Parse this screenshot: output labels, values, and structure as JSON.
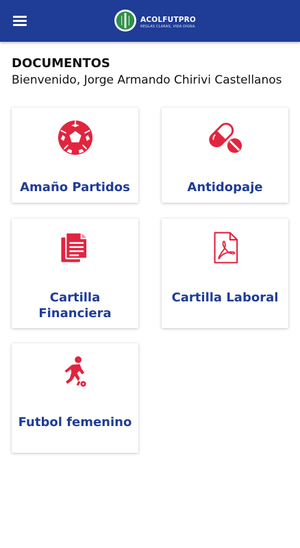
{
  "header": {
    "menu_icon": "hamburger-menu-icon",
    "logo": {
      "name": "ACOLFUTPRO",
      "tagline": "REGLAS CLARAS, VIDA DIGNA."
    }
  },
  "page": {
    "title": "DOCUMENTOS",
    "welcome": "Bienvenido, Jorge Armando Chirivi Castellanos"
  },
  "documents": [
    {
      "label": "Amaño Partidos",
      "icon": "soccer-ball-icon"
    },
    {
      "label": "Antidopaje",
      "icon": "pills-icon"
    },
    {
      "label": "Cartilla Financiera",
      "icon": "document-copy-icon"
    },
    {
      "label": "Cartilla Laboral",
      "icon": "pdf-file-icon"
    },
    {
      "label": "Futbol femenino",
      "icon": "soccer-player-icon"
    }
  ],
  "colors": {
    "appbar": "#1f3c96",
    "accent_red": "#e1253f",
    "label_blue": "#1f3c96"
  }
}
